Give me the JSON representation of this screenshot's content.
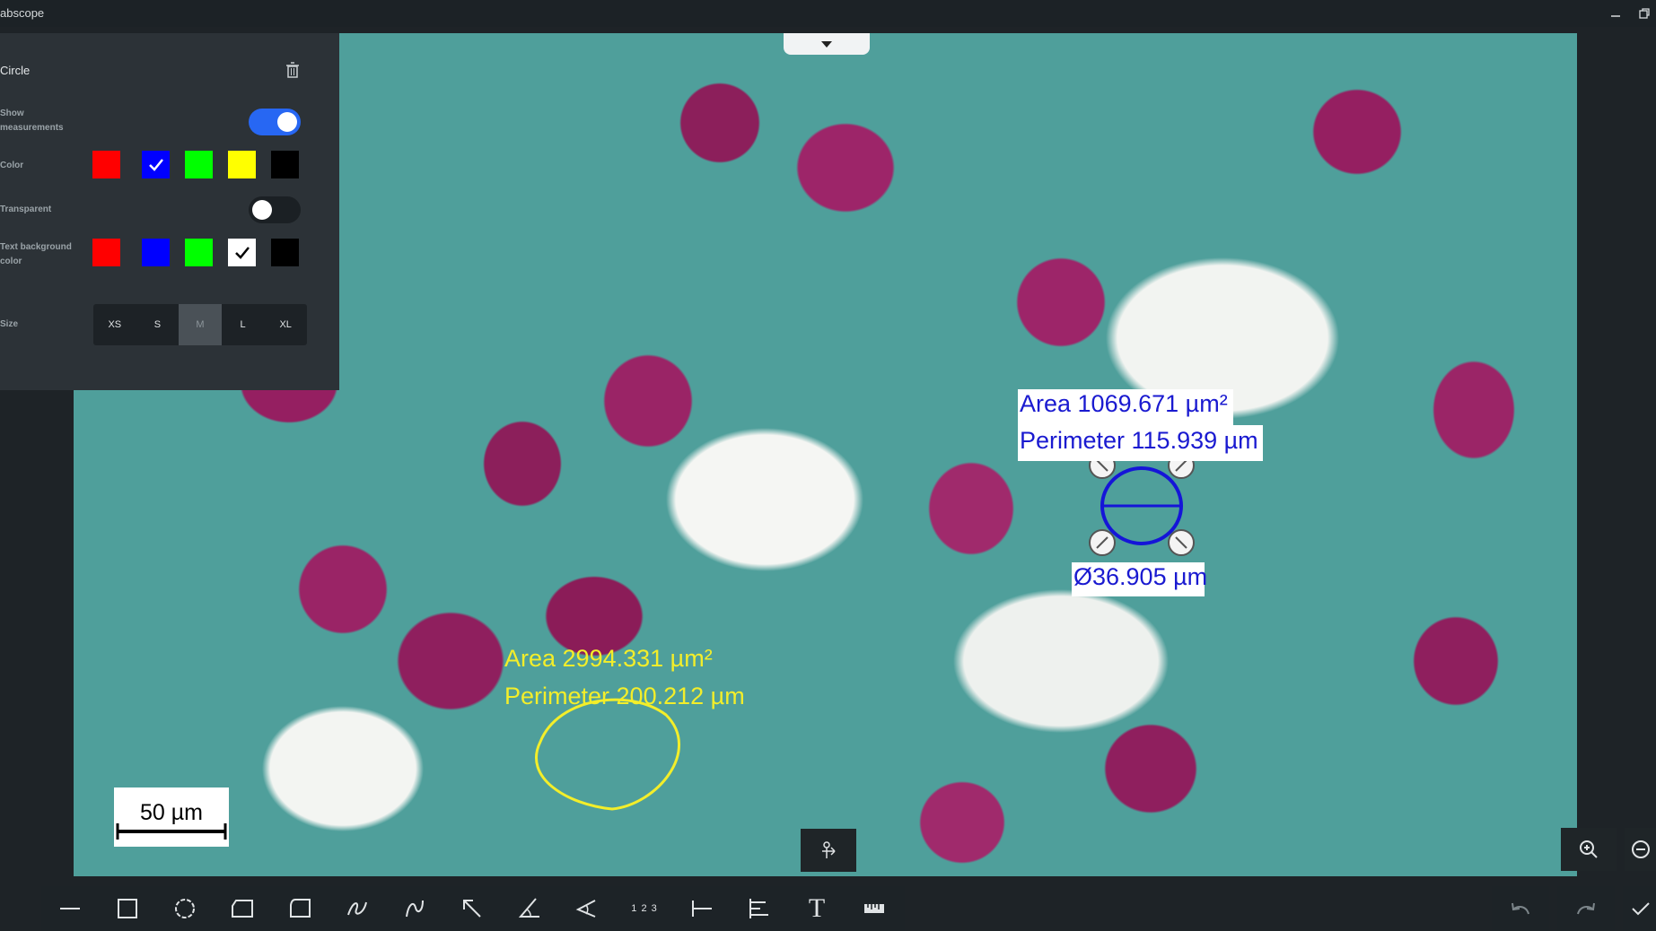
{
  "app": {
    "title": "abscope"
  },
  "sidebar": {
    "shape_name": "Circle",
    "show_measurements_label": "Show measurements",
    "show_measurements": true,
    "color_label": "Color",
    "colors": [
      "#ff0000",
      "#0000ff",
      "#00ff00",
      "#ffff00",
      "#000000"
    ],
    "selected_color_index": 1,
    "transparent_label": "Transparent",
    "transparent": false,
    "text_bg_label": "Text background color",
    "text_bg_colors": [
      "#ff0000",
      "#0000ff",
      "#00ff00",
      "#ffffff",
      "#000000"
    ],
    "selected_text_bg_index": 3,
    "size_label": "Size",
    "sizes": [
      "XS",
      "S",
      "M",
      "L",
      "XL"
    ],
    "selected_size": "M"
  },
  "annotations": {
    "blue": {
      "area": "Area 1069.671 µm²",
      "perimeter": "Perimeter 115.939 µm",
      "diameter": "Ø36.905 µm",
      "color": "#1a1ad0"
    },
    "yellow": {
      "area": "Area 2994.331 µm²",
      "perimeter": "Perimeter 200.212 µm",
      "color": "#f3ee2a"
    }
  },
  "scalebar": {
    "label": "50 µm"
  },
  "toolbar": {
    "tools": [
      "line-icon",
      "rectangle-icon",
      "circle-icon",
      "polygon-icon",
      "rounded-polygon-icon",
      "freehand-icon",
      "curve-icon",
      "arrow-icon",
      "angle-icon",
      "angle-alt-icon",
      "count-icon",
      "interval-icon",
      "align-icon",
      "text-icon",
      "ruler-icon"
    ],
    "count_label": "1 2 3",
    "text_label": "T"
  }
}
